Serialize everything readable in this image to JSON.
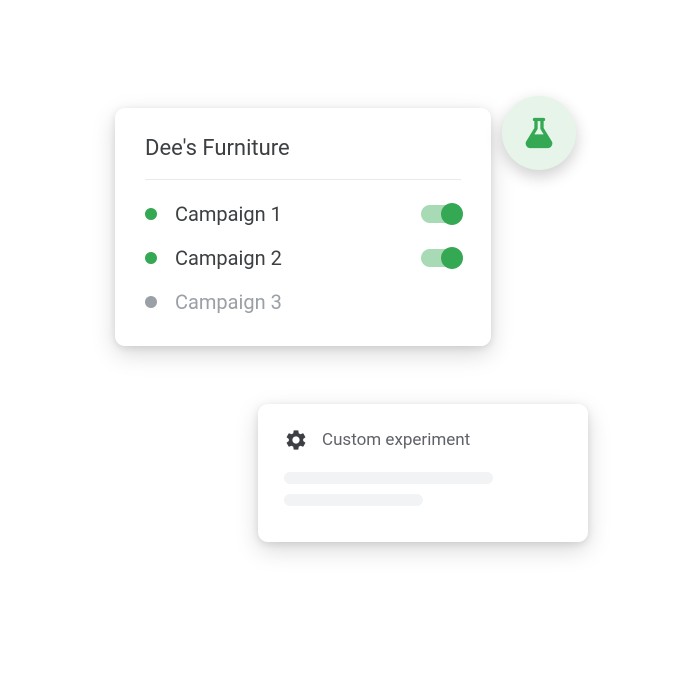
{
  "campaigns_card": {
    "title": "Dee's Furniture",
    "items": [
      {
        "label": "Campaign 1",
        "active": true
      },
      {
        "label": "Campaign 2",
        "active": true
      },
      {
        "label": "Campaign 3",
        "active": false
      }
    ]
  },
  "experiment_card": {
    "label": "Custom experiment"
  },
  "icons": {
    "flask": "flask-icon",
    "gear": "gear-icon"
  },
  "colors": {
    "green": "#34a853",
    "green_light": "#e6f4ea",
    "grey": "#9aa0a6",
    "text": "#3c4043"
  }
}
